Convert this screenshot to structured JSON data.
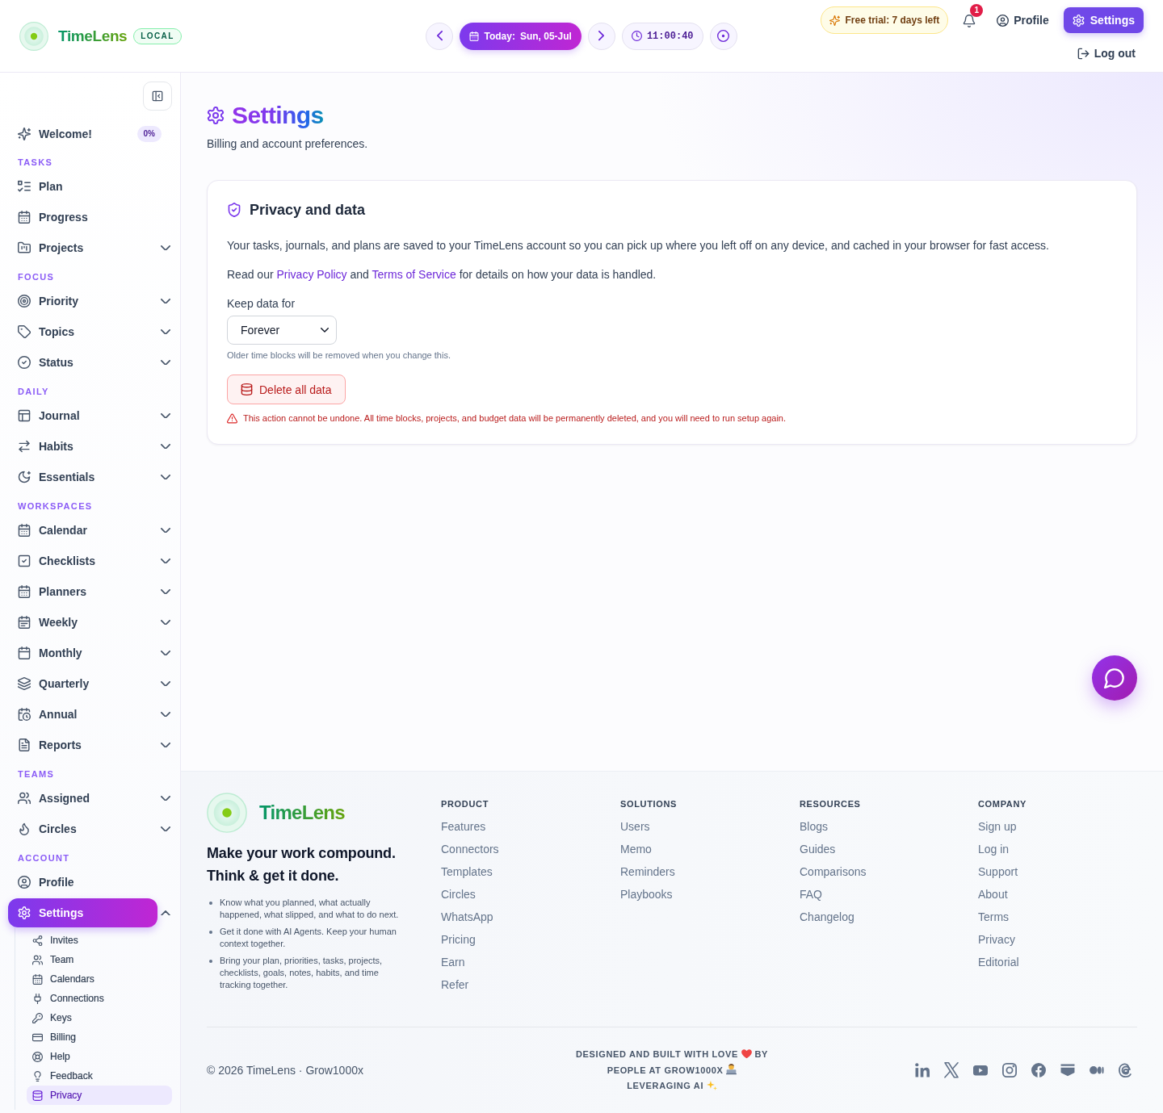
{
  "header": {
    "brand": "TimeLens",
    "mode_badge": "LOCAL",
    "date_label": "Today:",
    "date_value": "Sun, 05-Jul",
    "clock": "11:00:40",
    "trial": "Free trial: 7 days left",
    "notification_count": "1",
    "nav": [
      {
        "label": "Profile",
        "selected": false
      },
      {
        "label": "Settings",
        "selected": true
      }
    ],
    "logout": "Log out"
  },
  "sidebar": {
    "welcome": {
      "label": "Welcome!",
      "progress": "0%"
    },
    "sections": [
      {
        "title": "TASKS",
        "items": [
          {
            "label": "Plan",
            "kind": "link",
            "selected": false
          },
          {
            "label": "Progress",
            "kind": "link",
            "selected": false
          },
          {
            "label": "Projects",
            "kind": "menu",
            "expanded": false,
            "selected": false
          }
        ]
      },
      {
        "title": "FOCUS",
        "items": [
          {
            "label": "Priority",
            "kind": "menu",
            "expanded": false,
            "selected": false
          },
          {
            "label": "Topics",
            "kind": "menu",
            "expanded": false,
            "selected": false
          },
          {
            "label": "Status",
            "kind": "menu",
            "expanded": false,
            "selected": false
          }
        ]
      },
      {
        "title": "DAILY",
        "items": [
          {
            "label": "Journal",
            "kind": "menu",
            "expanded": false,
            "selected": false
          },
          {
            "label": "Habits",
            "kind": "menu",
            "expanded": false,
            "selected": false
          },
          {
            "label": "Essentials",
            "kind": "menu",
            "expanded": false,
            "selected": false
          }
        ]
      },
      {
        "title": "WORKSPACES",
        "items": [
          {
            "label": "Calendar",
            "kind": "menu",
            "expanded": false,
            "selected": false
          },
          {
            "label": "Checklists",
            "kind": "menu",
            "expanded": false,
            "selected": false
          },
          {
            "label": "Planners",
            "kind": "menu",
            "expanded": false,
            "selected": false
          },
          {
            "label": "Weekly",
            "kind": "menu",
            "expanded": false,
            "selected": false
          },
          {
            "label": "Monthly",
            "kind": "menu",
            "expanded": false,
            "selected": false
          },
          {
            "label": "Quarterly",
            "kind": "menu",
            "expanded": false,
            "selected": false
          },
          {
            "label": "Annual",
            "kind": "menu",
            "expanded": false,
            "selected": false
          },
          {
            "label": "Reports",
            "kind": "menu",
            "expanded": false,
            "selected": false
          }
        ]
      },
      {
        "title": "TEAMS",
        "items": [
          {
            "label": "Assigned",
            "kind": "menu",
            "expanded": false,
            "selected": false
          },
          {
            "label": "Circles",
            "kind": "menu",
            "expanded": false,
            "selected": false
          }
        ]
      },
      {
        "title": "ACCOUNT",
        "items": [
          {
            "label": "Profile",
            "kind": "link",
            "selected": false
          },
          {
            "label": "Settings",
            "kind": "menu",
            "expanded": true,
            "selected": true,
            "children": [
              {
                "label": "Invites",
                "selected": false
              },
              {
                "label": "Team",
                "selected": false
              },
              {
                "label": "Calendars",
                "selected": false
              },
              {
                "label": "Connections",
                "selected": false
              },
              {
                "label": "Keys",
                "selected": false
              },
              {
                "label": "Billing",
                "selected": false
              },
              {
                "label": "Help",
                "selected": false
              },
              {
                "label": "Feedback",
                "selected": false
              },
              {
                "label": "Privacy",
                "selected": true
              }
            ]
          }
        ]
      }
    ]
  },
  "page": {
    "title": "Settings",
    "subtitle": "Billing and account preferences."
  },
  "privacy": {
    "title": "Privacy and data",
    "description": "Your tasks, journals, and plans are saved to your TimeLens account so you can pick up where you left off on any device, and cached in your browser for fast access.",
    "policy_note": [
      {
        "kind": "text",
        "text": "Read our "
      },
      {
        "kind": "link",
        "text": "Privacy Policy"
      },
      {
        "kind": "text",
        "text": " and "
      },
      {
        "kind": "link",
        "text": "Terms of Service"
      },
      {
        "kind": "text",
        "text": " for details on how your data is handled."
      }
    ],
    "retention": {
      "label": "Keep data for",
      "value": "Forever",
      "hint": "Older time blocks will be removed when you change this."
    },
    "delete_button": "Delete all data",
    "warning": "This action cannot be undone. All time blocks, projects, and budget data will be permanently deleted, and you will need to run setup again."
  },
  "footer": {
    "brand": "TimeLens",
    "tagline": "Make your work compound. Think & get it done.",
    "bullets": [
      "Know what you planned, what actually happened, what slipped, and what to do next.",
      "Get it done with AI Agents. Keep your human context together.",
      "Bring your plan, priorities, tasks, projects, checklists, goals, notes, habits, and time tracking together."
    ],
    "columns": [
      {
        "title": "PRODUCT",
        "links": [
          "Features",
          "Connectors",
          "Templates",
          "Circles",
          "WhatsApp",
          "Pricing",
          "Earn",
          "Refer"
        ]
      },
      {
        "title": "SOLUTIONS",
        "links": [
          "Users",
          "Memo",
          "Reminders",
          "Playbooks"
        ]
      },
      {
        "title": "RESOURCES",
        "links": [
          "Blogs",
          "Guides",
          "Comparisons",
          "FAQ",
          "Changelog"
        ]
      },
      {
        "title": "COMPANY",
        "links": [
          "Sign up",
          "Log in",
          "Support",
          "About",
          "Terms",
          "Privacy",
          "Editorial"
        ]
      }
    ],
    "copyright": "© 2026 TimeLens · Grow1000x",
    "credit_lines": [
      {
        "text": "DESIGNED AND BUILT WITH LOVE",
        "after": "BY"
      },
      {
        "text": "PEOPLE AT GROW1000X"
      },
      {
        "text": "LEVERAGING AI"
      }
    ]
  }
}
